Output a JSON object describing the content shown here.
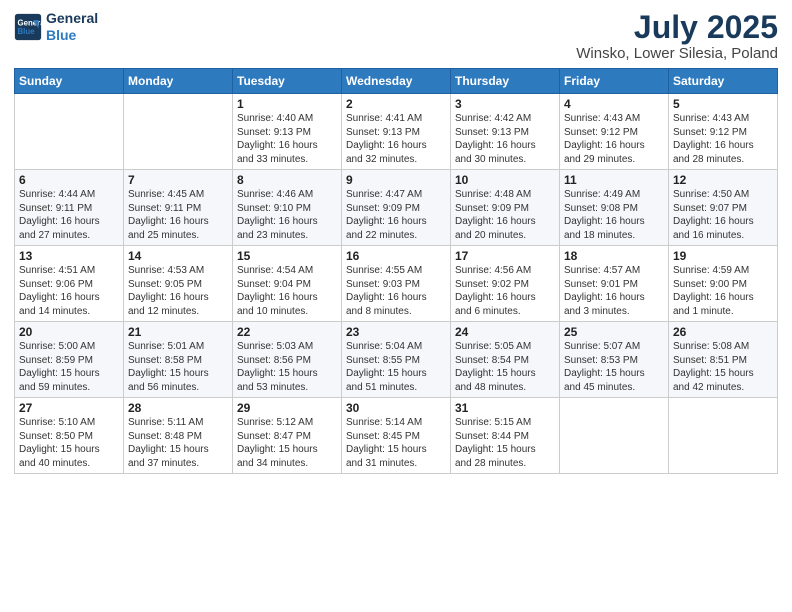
{
  "logo": {
    "line1": "General",
    "line2": "Blue"
  },
  "title": "July 2025",
  "subtitle": "Winsko, Lower Silesia, Poland",
  "days_of_week": [
    "Sunday",
    "Monday",
    "Tuesday",
    "Wednesday",
    "Thursday",
    "Friday",
    "Saturday"
  ],
  "weeks": [
    [
      {
        "day": "",
        "detail": ""
      },
      {
        "day": "",
        "detail": ""
      },
      {
        "day": "1",
        "detail": "Sunrise: 4:40 AM\nSunset: 9:13 PM\nDaylight: 16 hours\nand 33 minutes."
      },
      {
        "day": "2",
        "detail": "Sunrise: 4:41 AM\nSunset: 9:13 PM\nDaylight: 16 hours\nand 32 minutes."
      },
      {
        "day": "3",
        "detail": "Sunrise: 4:42 AM\nSunset: 9:13 PM\nDaylight: 16 hours\nand 30 minutes."
      },
      {
        "day": "4",
        "detail": "Sunrise: 4:43 AM\nSunset: 9:12 PM\nDaylight: 16 hours\nand 29 minutes."
      },
      {
        "day": "5",
        "detail": "Sunrise: 4:43 AM\nSunset: 9:12 PM\nDaylight: 16 hours\nand 28 minutes."
      }
    ],
    [
      {
        "day": "6",
        "detail": "Sunrise: 4:44 AM\nSunset: 9:11 PM\nDaylight: 16 hours\nand 27 minutes."
      },
      {
        "day": "7",
        "detail": "Sunrise: 4:45 AM\nSunset: 9:11 PM\nDaylight: 16 hours\nand 25 minutes."
      },
      {
        "day": "8",
        "detail": "Sunrise: 4:46 AM\nSunset: 9:10 PM\nDaylight: 16 hours\nand 23 minutes."
      },
      {
        "day": "9",
        "detail": "Sunrise: 4:47 AM\nSunset: 9:09 PM\nDaylight: 16 hours\nand 22 minutes."
      },
      {
        "day": "10",
        "detail": "Sunrise: 4:48 AM\nSunset: 9:09 PM\nDaylight: 16 hours\nand 20 minutes."
      },
      {
        "day": "11",
        "detail": "Sunrise: 4:49 AM\nSunset: 9:08 PM\nDaylight: 16 hours\nand 18 minutes."
      },
      {
        "day": "12",
        "detail": "Sunrise: 4:50 AM\nSunset: 9:07 PM\nDaylight: 16 hours\nand 16 minutes."
      }
    ],
    [
      {
        "day": "13",
        "detail": "Sunrise: 4:51 AM\nSunset: 9:06 PM\nDaylight: 16 hours\nand 14 minutes."
      },
      {
        "day": "14",
        "detail": "Sunrise: 4:53 AM\nSunset: 9:05 PM\nDaylight: 16 hours\nand 12 minutes."
      },
      {
        "day": "15",
        "detail": "Sunrise: 4:54 AM\nSunset: 9:04 PM\nDaylight: 16 hours\nand 10 minutes."
      },
      {
        "day": "16",
        "detail": "Sunrise: 4:55 AM\nSunset: 9:03 PM\nDaylight: 16 hours\nand 8 minutes."
      },
      {
        "day": "17",
        "detail": "Sunrise: 4:56 AM\nSunset: 9:02 PM\nDaylight: 16 hours\nand 6 minutes."
      },
      {
        "day": "18",
        "detail": "Sunrise: 4:57 AM\nSunset: 9:01 PM\nDaylight: 16 hours\nand 3 minutes."
      },
      {
        "day": "19",
        "detail": "Sunrise: 4:59 AM\nSunset: 9:00 PM\nDaylight: 16 hours\nand 1 minute."
      }
    ],
    [
      {
        "day": "20",
        "detail": "Sunrise: 5:00 AM\nSunset: 8:59 PM\nDaylight: 15 hours\nand 59 minutes."
      },
      {
        "day": "21",
        "detail": "Sunrise: 5:01 AM\nSunset: 8:58 PM\nDaylight: 15 hours\nand 56 minutes."
      },
      {
        "day": "22",
        "detail": "Sunrise: 5:03 AM\nSunset: 8:56 PM\nDaylight: 15 hours\nand 53 minutes."
      },
      {
        "day": "23",
        "detail": "Sunrise: 5:04 AM\nSunset: 8:55 PM\nDaylight: 15 hours\nand 51 minutes."
      },
      {
        "day": "24",
        "detail": "Sunrise: 5:05 AM\nSunset: 8:54 PM\nDaylight: 15 hours\nand 48 minutes."
      },
      {
        "day": "25",
        "detail": "Sunrise: 5:07 AM\nSunset: 8:53 PM\nDaylight: 15 hours\nand 45 minutes."
      },
      {
        "day": "26",
        "detail": "Sunrise: 5:08 AM\nSunset: 8:51 PM\nDaylight: 15 hours\nand 42 minutes."
      }
    ],
    [
      {
        "day": "27",
        "detail": "Sunrise: 5:10 AM\nSunset: 8:50 PM\nDaylight: 15 hours\nand 40 minutes."
      },
      {
        "day": "28",
        "detail": "Sunrise: 5:11 AM\nSunset: 8:48 PM\nDaylight: 15 hours\nand 37 minutes."
      },
      {
        "day": "29",
        "detail": "Sunrise: 5:12 AM\nSunset: 8:47 PM\nDaylight: 15 hours\nand 34 minutes."
      },
      {
        "day": "30",
        "detail": "Sunrise: 5:14 AM\nSunset: 8:45 PM\nDaylight: 15 hours\nand 31 minutes."
      },
      {
        "day": "31",
        "detail": "Sunrise: 5:15 AM\nSunset: 8:44 PM\nDaylight: 15 hours\nand 28 minutes."
      },
      {
        "day": "",
        "detail": ""
      },
      {
        "day": "",
        "detail": ""
      }
    ]
  ]
}
